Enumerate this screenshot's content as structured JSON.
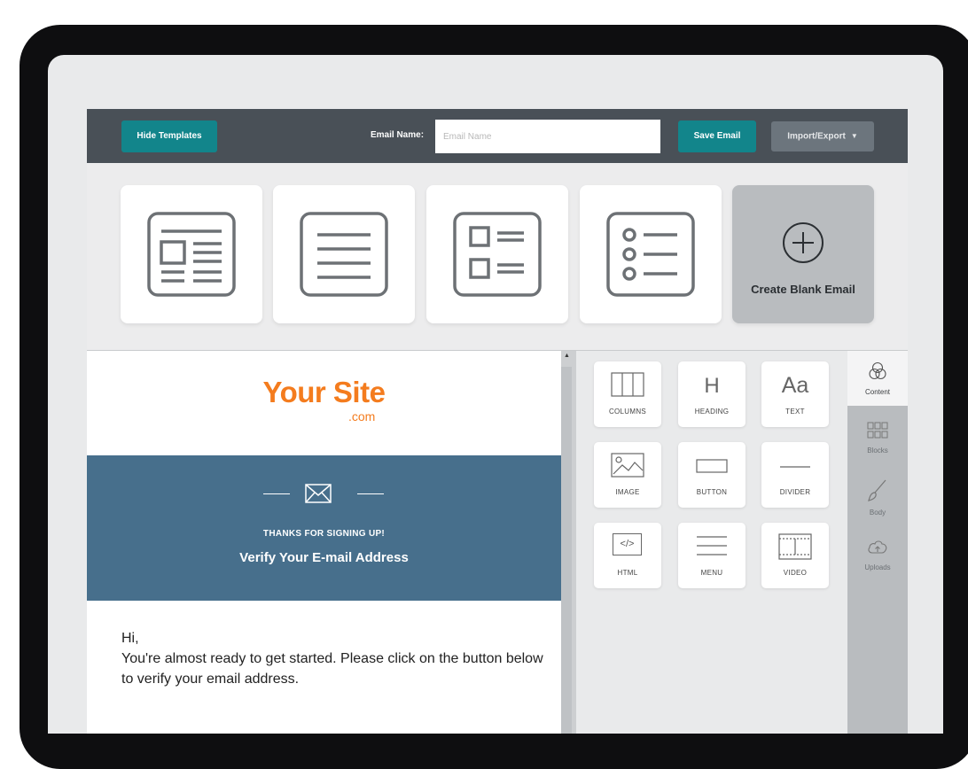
{
  "toolbar": {
    "hide_templates": "Hide Templates",
    "email_name_label": "Email Name:",
    "email_name_placeholder": "Email Name",
    "email_name_value": "",
    "save_email": "Save Email",
    "import_export": "Import/Export"
  },
  "templates": {
    "items": [
      {
        "icon": "newsletter-template-icon"
      },
      {
        "icon": "text-template-icon"
      },
      {
        "icon": "checklist-template-icon"
      },
      {
        "icon": "bullet-list-template-icon"
      }
    ],
    "create_blank": "Create Blank Email"
  },
  "canvas": {
    "logo_main": "Your Site",
    "logo_sub": ".com",
    "hero_kicker": "THANKS FOR SIGNING UP!",
    "hero_title": "Verify Your E-mail Address",
    "greeting": "Hi,",
    "body": "You're almost ready to get started. Please click on the button below to verify your email address."
  },
  "blocks": [
    {
      "label": "COLUMNS",
      "icon": "columns-icon"
    },
    {
      "label": "HEADING",
      "icon": "heading-icon"
    },
    {
      "label": "TEXT",
      "icon": "text-icon"
    },
    {
      "label": "IMAGE",
      "icon": "image-icon"
    },
    {
      "label": "BUTTON",
      "icon": "button-icon"
    },
    {
      "label": "DIVIDER",
      "icon": "divider-icon"
    },
    {
      "label": "HTML",
      "icon": "html-icon"
    },
    {
      "label": "MENU",
      "icon": "menu-icon"
    },
    {
      "label": "VIDEO",
      "icon": "video-icon"
    }
  ],
  "block_glyphs": {
    "heading": "H",
    "text": "Aa",
    "html": "</>"
  },
  "sidebar": [
    {
      "label": "Content",
      "icon": "content-icon",
      "active": true
    },
    {
      "label": "Blocks",
      "icon": "blocks-icon",
      "active": false
    },
    {
      "label": "Body",
      "icon": "brush-icon",
      "active": false
    },
    {
      "label": "Uploads",
      "icon": "upload-cloud-icon",
      "active": false
    }
  ],
  "colors": {
    "toolbar_bg": "#495057",
    "accent_teal": "#12858b",
    "brand_orange": "#f47c1e",
    "hero_blue": "#476f8c"
  }
}
